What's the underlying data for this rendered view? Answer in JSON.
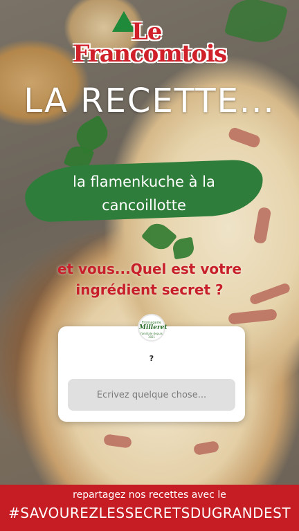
{
  "brand": {
    "le": "Le",
    "name": "Francomtois"
  },
  "headline": "LA RECETTE...",
  "recipe_title_line1": "la flamenkuche à la",
  "recipe_title_line2": "cancoillotte",
  "question": {
    "line1": "et vous...Quel est votre",
    "line2": "ingrédient secret ?"
  },
  "question_card": {
    "badge": {
      "top": "Fromagerie",
      "name": "Milleret",
      "bottom": "familiale depuis 1921"
    },
    "prompt": "?",
    "answer_placeholder": "Écrivez quelque chose..."
  },
  "footer": {
    "line1": "repartagez nos recettes avec le",
    "hashtag": "#SAVOUREZLESSECRETSDUGRANDEST"
  },
  "colors": {
    "brand_red": "#c61d24",
    "leaf_green": "#2f7d3a"
  }
}
